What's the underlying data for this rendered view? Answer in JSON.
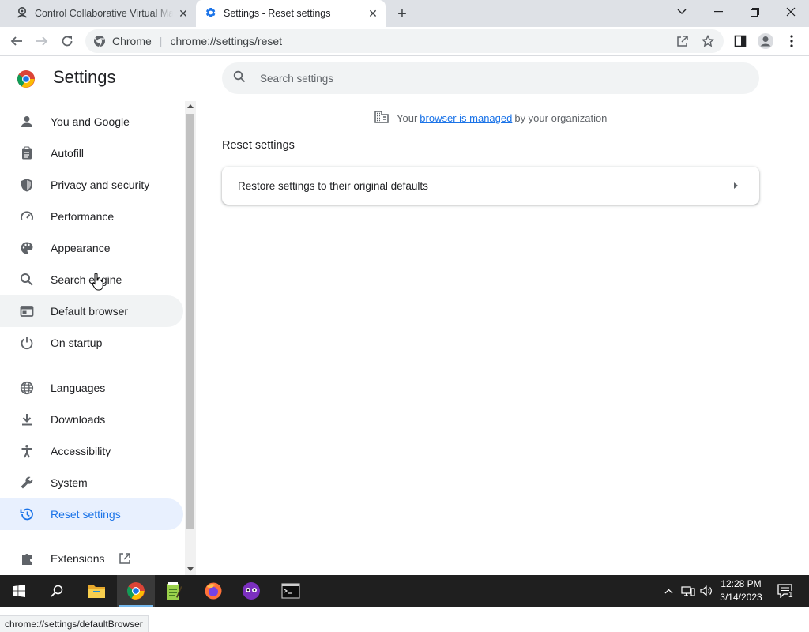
{
  "browser": {
    "tabs": [
      {
        "title": "Control Collaborative Virtual Machine",
        "icon": "collab-vm-icon",
        "active": false
      },
      {
        "title": "Settings - Reset settings",
        "icon": "gear-icon",
        "active": true
      }
    ],
    "omnibox": {
      "site_label": "Chrome",
      "url": "chrome://settings/reset"
    }
  },
  "settings": {
    "title": "Settings",
    "search_placeholder": "Search settings",
    "nav": [
      {
        "label": "You and Google",
        "icon": "person-icon"
      },
      {
        "label": "Autofill",
        "icon": "clipboard-icon"
      },
      {
        "label": "Privacy and security",
        "icon": "shield-icon"
      },
      {
        "label": "Performance",
        "icon": "speedometer-icon"
      },
      {
        "label": "Appearance",
        "icon": "palette-icon"
      },
      {
        "label": "Search engine",
        "icon": "search-icon"
      },
      {
        "label": "Default browser",
        "icon": "browser-window-icon",
        "state": "hover"
      },
      {
        "label": "On startup",
        "icon": "power-icon"
      },
      {
        "label": "Languages",
        "icon": "globe-icon"
      },
      {
        "label": "Downloads",
        "icon": "download-icon"
      },
      {
        "label": "Accessibility",
        "icon": "accessibility-icon"
      },
      {
        "label": "System",
        "icon": "wrench-icon"
      },
      {
        "label": "Reset settings",
        "icon": "reset-history-icon",
        "state": "active"
      },
      {
        "label": "Extensions",
        "icon": "puzzle-icon"
      }
    ],
    "managed_notice": {
      "prefix": "Your",
      "link": "browser is managed",
      "suffix": "by your organization"
    },
    "section_title": "Reset settings",
    "reset_row_label": "Restore settings to their original defaults"
  },
  "status_bar": {
    "url": "chrome://settings/defaultBrowser"
  },
  "taskbar": {
    "apps": [
      "windows-start-icon",
      "search-icon",
      "file-explorer-icon",
      "chrome-icon",
      "notepad-plus-icon",
      "firefox-icon",
      "app-icon",
      "terminal-icon"
    ],
    "time": "12:28 PM",
    "date": "3/14/2023",
    "notification_count": "1"
  },
  "colors": {
    "accent": "#1a73e8",
    "active_nav_bg": "#e8f0fe",
    "hover_nav_bg": "#f1f3f4",
    "tabstrip_bg": "#dee1e6",
    "taskbar_bg": "#1f1f1f"
  }
}
